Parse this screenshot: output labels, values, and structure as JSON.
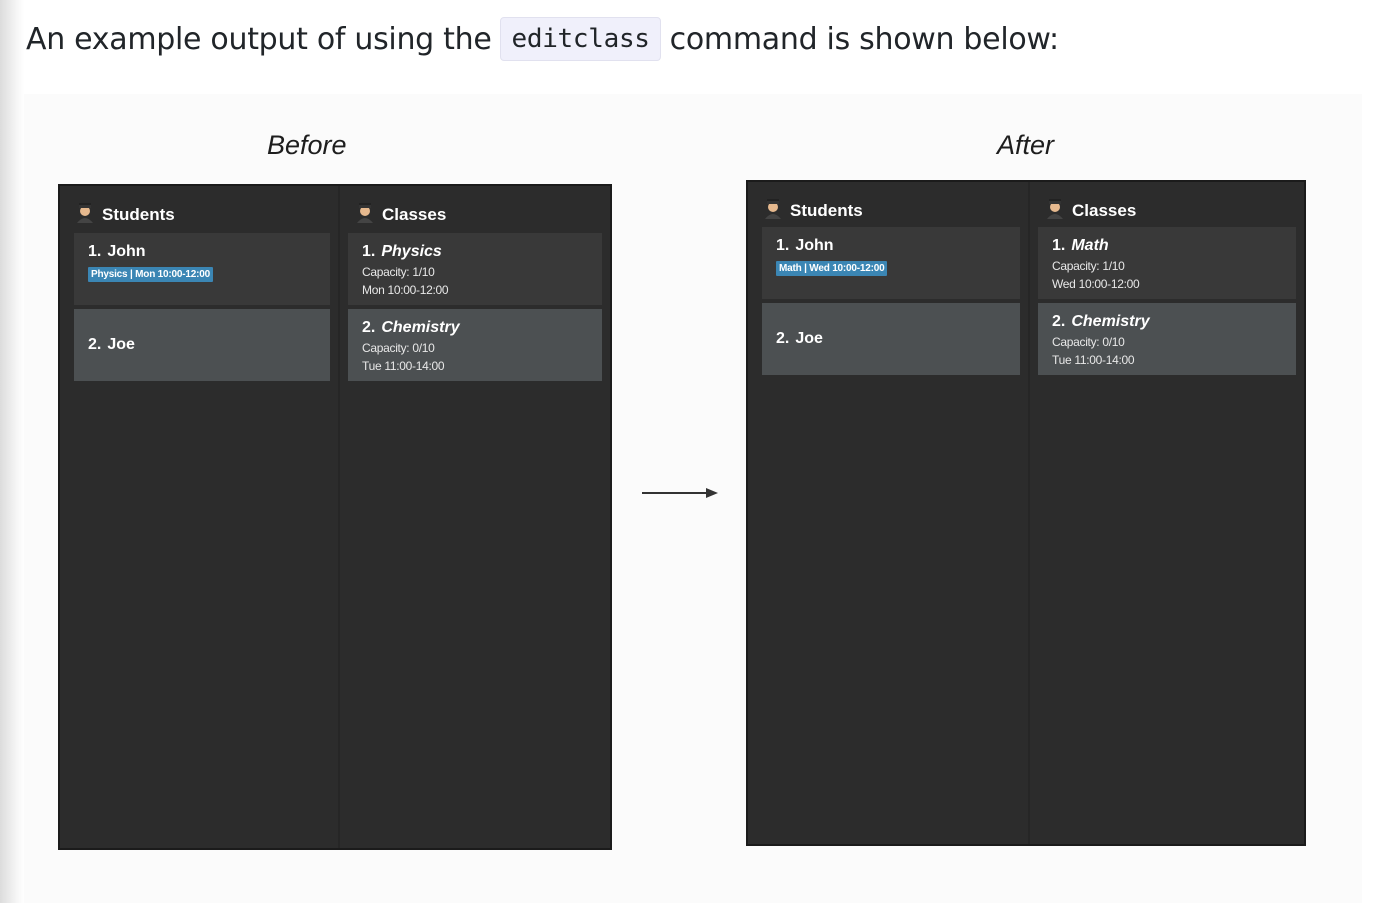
{
  "intro": {
    "before_text": "An example output of using the",
    "command": "editclass",
    "after_text": "command is shown below:"
  },
  "figure": {
    "before_caption": "Before",
    "after_caption": "After",
    "arrow_icon": "right-arrow-icon"
  },
  "before": {
    "students_header": "Students",
    "classes_header": "Classes",
    "students": [
      {
        "index": "1.",
        "name": "John",
        "tag": "Physics | Mon 10:00-12:00"
      },
      {
        "index": "2.",
        "name": "Joe"
      }
    ],
    "classes": [
      {
        "index": "1.",
        "name": "Physics",
        "capacity": "Capacity: 1/10",
        "time": "Mon 10:00-12:00"
      },
      {
        "index": "2.",
        "name": "Chemistry",
        "capacity": "Capacity: 0/10",
        "time": "Tue 11:00-14:00"
      }
    ]
  },
  "after": {
    "students_header": "Students",
    "classes_header": "Classes",
    "students": [
      {
        "index": "1.",
        "name": "John",
        "tag": "Math | Wed 10:00-12:00"
      },
      {
        "index": "2.",
        "name": "Joe"
      }
    ],
    "classes": [
      {
        "index": "1.",
        "name": "Math",
        "capacity": "Capacity: 1/10",
        "time": "Wed 10:00-12:00"
      },
      {
        "index": "2.",
        "name": "Chemistry",
        "capacity": "Capacity: 0/10",
        "time": "Tue 11:00-14:00"
      }
    ]
  },
  "colors": {
    "app_background": "#2c2c2c",
    "card_odd": "#393939",
    "card_even": "#4c5052",
    "tag_blue": "#3b86b4"
  }
}
